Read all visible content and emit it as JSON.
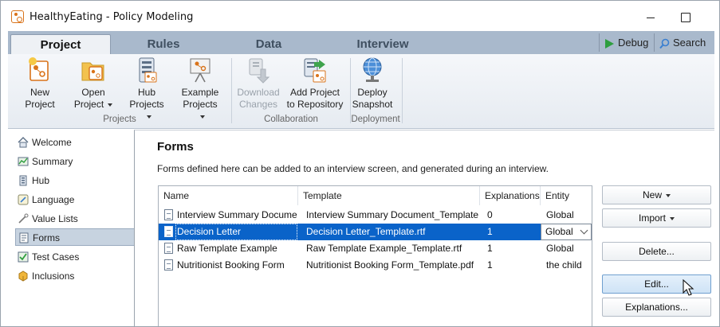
{
  "window": {
    "title": "HealthyEating - Policy Modeling"
  },
  "tabs": [
    "Project",
    "Rules",
    "Data",
    "Interview"
  ],
  "toolbar": {
    "debug_label": "Debug",
    "search_label": "Search"
  },
  "ribbon": {
    "buttons": [
      {
        "line1": "New",
        "line2": "Project",
        "dropdown": false,
        "disabled": false,
        "icon": "new-project-icon"
      },
      {
        "line1": "Open",
        "line2": "Project",
        "dropdown": true,
        "disabled": false,
        "icon": "open-project-icon"
      },
      {
        "line1": "Hub",
        "line2": "Projects",
        "dropdown": true,
        "disabled": false,
        "icon": "hub-projects-icon"
      },
      {
        "line1": "Example",
        "line2": "Projects",
        "dropdown": true,
        "disabled": false,
        "icon": "example-projects-icon"
      },
      {
        "line1": "Download",
        "line2": "Changes",
        "dropdown": false,
        "disabled": true,
        "icon": "download-changes-icon"
      },
      {
        "line1": "Add Project",
        "line2": "to Repository",
        "dropdown": false,
        "disabled": false,
        "icon": "add-to-repository-icon"
      },
      {
        "line1": "Deploy",
        "line2": "Snapshot",
        "dropdown": false,
        "disabled": false,
        "icon": "deploy-snapshot-icon"
      }
    ],
    "groups": [
      "Projects",
      "Collaboration",
      "Deployment"
    ]
  },
  "sidebar": {
    "items": [
      {
        "label": "Welcome",
        "icon": "home-icon"
      },
      {
        "label": "Summary",
        "icon": "summary-icon"
      },
      {
        "label": "Hub",
        "icon": "hub-icon"
      },
      {
        "label": "Language",
        "icon": "language-icon"
      },
      {
        "label": "Value Lists",
        "icon": "value-lists-icon"
      },
      {
        "label": "Forms",
        "icon": "forms-icon",
        "selected": true
      },
      {
        "label": "Test Cases",
        "icon": "test-cases-icon"
      },
      {
        "label": "Inclusions",
        "icon": "inclusions-icon"
      }
    ]
  },
  "main": {
    "title": "Forms",
    "description": "Forms defined here can be added to an interview screen, and generated during an interview.",
    "columns": [
      "Name",
      "Template",
      "Explanations",
      "Entity"
    ],
    "rows": [
      {
        "name": "Interview Summary Document",
        "template": "Interview Summary Document_Template.rtf",
        "explanations": "0",
        "entity": "Global"
      },
      {
        "name": "Decision Letter",
        "template": "Decision Letter_Template.rtf",
        "explanations": "1",
        "entity": "Global",
        "selected": true
      },
      {
        "name": "Raw Template Example",
        "template": "Raw Template Example_Template.rtf",
        "explanations": "1",
        "entity": "Global"
      },
      {
        "name": "Nutritionist Booking Form",
        "template": "Nutritionist Booking Form_Template.pdf",
        "explanations": "1",
        "entity": "the child"
      }
    ],
    "actions": {
      "new": "New",
      "import": "Import",
      "delete": "Delete...",
      "edit": "Edit...",
      "explanations": "Explanations..."
    }
  },
  "colors": {
    "accent_orange": "#d9731a",
    "tab_strip": "#a9b9cc",
    "selection": "#0a63c9",
    "debug_green": "#2e9e3f",
    "search_blue": "#3a7fd0"
  }
}
